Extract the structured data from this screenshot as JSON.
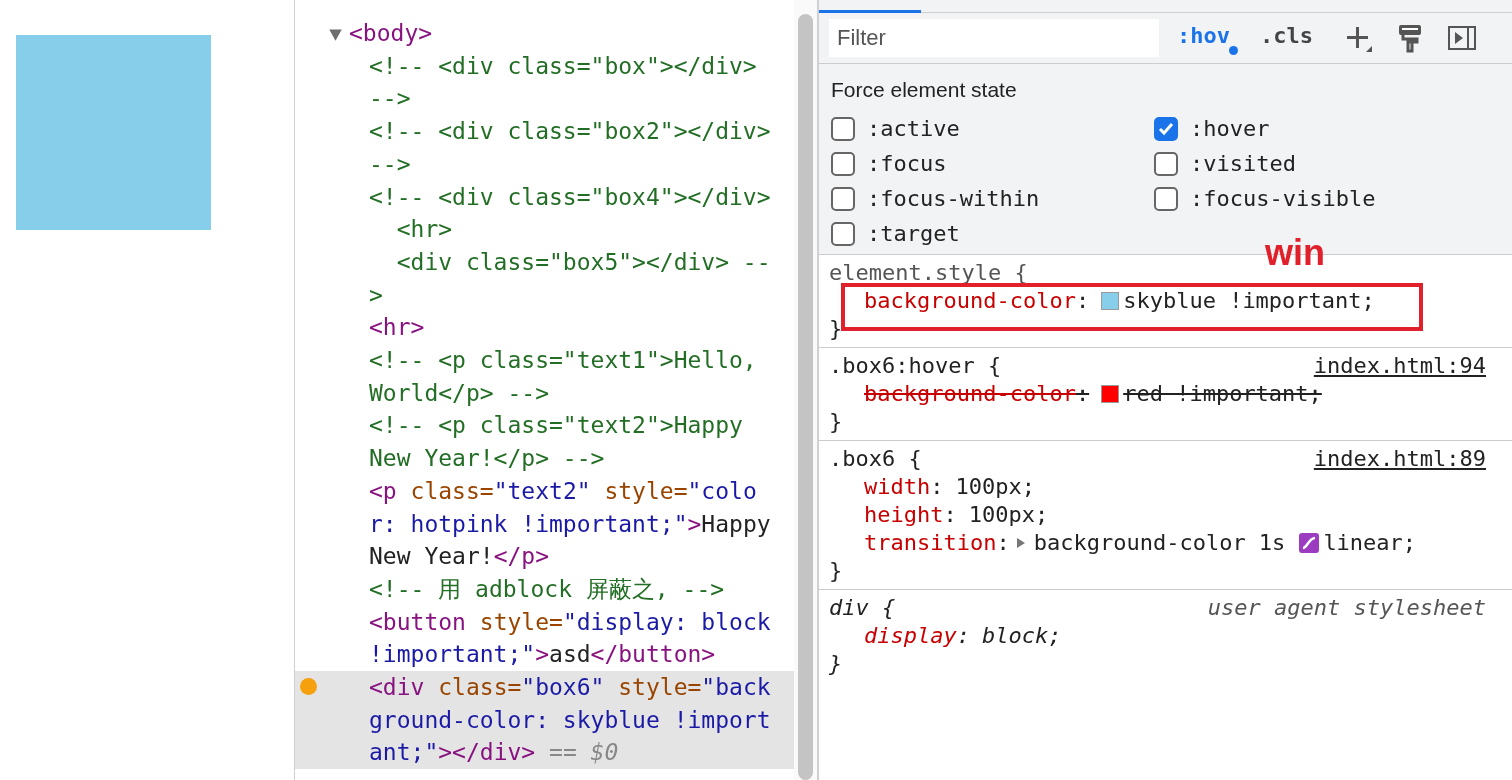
{
  "elements_panel": {
    "nodes": [
      {
        "expanded": true,
        "selected": false,
        "lines": [
          [
            {
              "kind": "tag",
              "text": "<body>"
            }
          ]
        ],
        "children": [
          {
            "selected": false,
            "forced_state": false,
            "lines": [
              [
                {
                  "kind": "comment",
                  "text": "<!-- <div class=\"box\"></div>"
                }
              ],
              [
                {
                  "kind": "comment",
                  "text": "-->"
                }
              ]
            ]
          },
          {
            "selected": false,
            "forced_state": false,
            "lines": [
              [
                {
                  "kind": "comment",
                  "text": "<!-- <div class=\"box2\"></div>"
                }
              ],
              [
                {
                  "kind": "comment",
                  "text": "-->"
                }
              ]
            ]
          },
          {
            "selected": false,
            "forced_state": false,
            "lines": [
              [
                {
                  "kind": "comment",
                  "text": "<!-- <div class=\"box4\"></div>"
                }
              ],
              [
                {
                  "kind": "comment",
                  "text": "  <hr>"
                }
              ],
              [
                {
                  "kind": "comment",
                  "text": "  <div class=\"box5\"></div> --"
                }
              ],
              [
                {
                  "kind": "comment",
                  "text": ">"
                }
              ]
            ]
          },
          {
            "selected": false,
            "forced_state": false,
            "lines": [
              [
                {
                  "kind": "tag",
                  "text": "<hr>"
                }
              ]
            ]
          },
          {
            "selected": false,
            "forced_state": false,
            "lines": [
              [
                {
                  "kind": "comment",
                  "text": "<!-- <p class=\"text1\">Hello,"
                }
              ],
              [
                {
                  "kind": "comment",
                  "text": "World</p> -->"
                }
              ]
            ]
          },
          {
            "selected": false,
            "forced_state": false,
            "lines": [
              [
                {
                  "kind": "comment",
                  "text": "<!-- <p class=\"text2\">Happy"
                }
              ],
              [
                {
                  "kind": "comment",
                  "text": "New Year!</p> -->"
                }
              ]
            ]
          },
          {
            "selected": false,
            "forced_state": false,
            "lines": [
              [
                {
                  "kind": "tag",
                  "text": "<p"
                },
                {
                  "kind": "attr",
                  "text": " class="
                },
                {
                  "kind": "value",
                  "text": "\"text2\""
                },
                {
                  "kind": "attr",
                  "text": " style="
                },
                {
                  "kind": "value",
                  "text": "\"colo"
                }
              ],
              [
                {
                  "kind": "value",
                  "text": "r: hotpink !important;\""
                },
                {
                  "kind": "tag",
                  "text": ">"
                },
                {
                  "kind": "text",
                  "text": "Happy"
                }
              ],
              [
                {
                  "kind": "text",
                  "text": "New Year!"
                },
                {
                  "kind": "tag",
                  "text": "</p>"
                }
              ]
            ]
          },
          {
            "selected": false,
            "forced_state": false,
            "lines": [
              [
                {
                  "kind": "comment",
                  "text": "<!-- 用 adblock 屏蔽之, -->"
                }
              ]
            ]
          },
          {
            "selected": false,
            "forced_state": false,
            "lines": [
              [
                {
                  "kind": "tag",
                  "text": "<button"
                },
                {
                  "kind": "attr",
                  "text": " style="
                },
                {
                  "kind": "value",
                  "text": "\"display: block"
                }
              ],
              [
                {
                  "kind": "value",
                  "text": "!important;\""
                },
                {
                  "kind": "tag",
                  "text": ">"
                },
                {
                  "kind": "text",
                  "text": "asd"
                },
                {
                  "kind": "tag",
                  "text": "</button>"
                }
              ]
            ]
          },
          {
            "selected": true,
            "forced_state": true,
            "lines": [
              [
                {
                  "kind": "tag",
                  "text": "<div"
                },
                {
                  "kind": "attr",
                  "text": " class="
                },
                {
                  "kind": "value",
                  "text": "\"box6\""
                },
                {
                  "kind": "attr",
                  "text": " style="
                },
                {
                  "kind": "value",
                  "text": "\"back"
                }
              ],
              [
                {
                  "kind": "value",
                  "text": "ground-color: skyblue !import"
                }
              ],
              [
                {
                  "kind": "value",
                  "text": "ant;\""
                },
                {
                  "kind": "tag",
                  "text": "></div>"
                },
                {
                  "kind": "ref",
                  "text": " == $0"
                }
              ]
            ]
          }
        ]
      }
    ]
  },
  "styles_pane": {
    "filter": {
      "placeholder": "Filter"
    },
    "toolbar": [
      {
        "kind": "text",
        "label": ":hov",
        "active": true
      },
      {
        "kind": "text",
        "label": ".cls",
        "active": false
      },
      {
        "kind": "plus"
      },
      {
        "kind": "roller"
      },
      {
        "kind": "sidebar"
      }
    ],
    "force_state": {
      "title": "Force element state",
      "states": [
        {
          "label": ":active",
          "checked": false
        },
        {
          "label": ":hover",
          "checked": true
        },
        {
          "label": ":focus",
          "checked": false
        },
        {
          "label": ":visited",
          "checked": false
        },
        {
          "label": ":focus-within",
          "checked": false
        },
        {
          "label": ":focus-visible",
          "checked": false
        },
        {
          "label": ":target",
          "checked": false
        }
      ]
    },
    "rules": [
      {
        "kind": "inline",
        "selector": "element.style",
        "open": "{",
        "close": "}",
        "props": [
          {
            "name": "background-color",
            "colon": ":",
            "color": "#87ceeb",
            "value": "skyblue !important;",
            "overridden": false,
            "highlighted": true
          }
        ]
      },
      {
        "kind": "author",
        "selector": ".box6:hover",
        "open": "{",
        "source": "index.html:94",
        "close": "}",
        "props": [
          {
            "name": "background-color",
            "colon": ":",
            "color": "#ff0000",
            "value": "red !important;",
            "overridden": true,
            "highlighted": false
          }
        ]
      },
      {
        "kind": "author",
        "selector": ".box6",
        "open": "{",
        "source": "index.html:89",
        "close": "}",
        "props": [
          {
            "name": "width",
            "colon": ":",
            "value": "100px;",
            "overridden": false,
            "highlighted": false
          },
          {
            "name": "height",
            "colon": ":",
            "value": "100px;",
            "overridden": false,
            "highlighted": false
          },
          {
            "name": "transition",
            "colon": ":",
            "expandable": true,
            "value": "background-color 1s",
            "easing": "linear;",
            "overridden": false,
            "highlighted": false
          }
        ]
      },
      {
        "kind": "user_agent",
        "selector": "div",
        "open": "{",
        "source": "user agent stylesheet",
        "close": "}",
        "props": [
          {
            "name": "display",
            "colon": ":",
            "value": "block;",
            "overridden": false,
            "highlighted": false
          }
        ]
      }
    ],
    "annotation": {
      "label": "win"
    }
  }
}
